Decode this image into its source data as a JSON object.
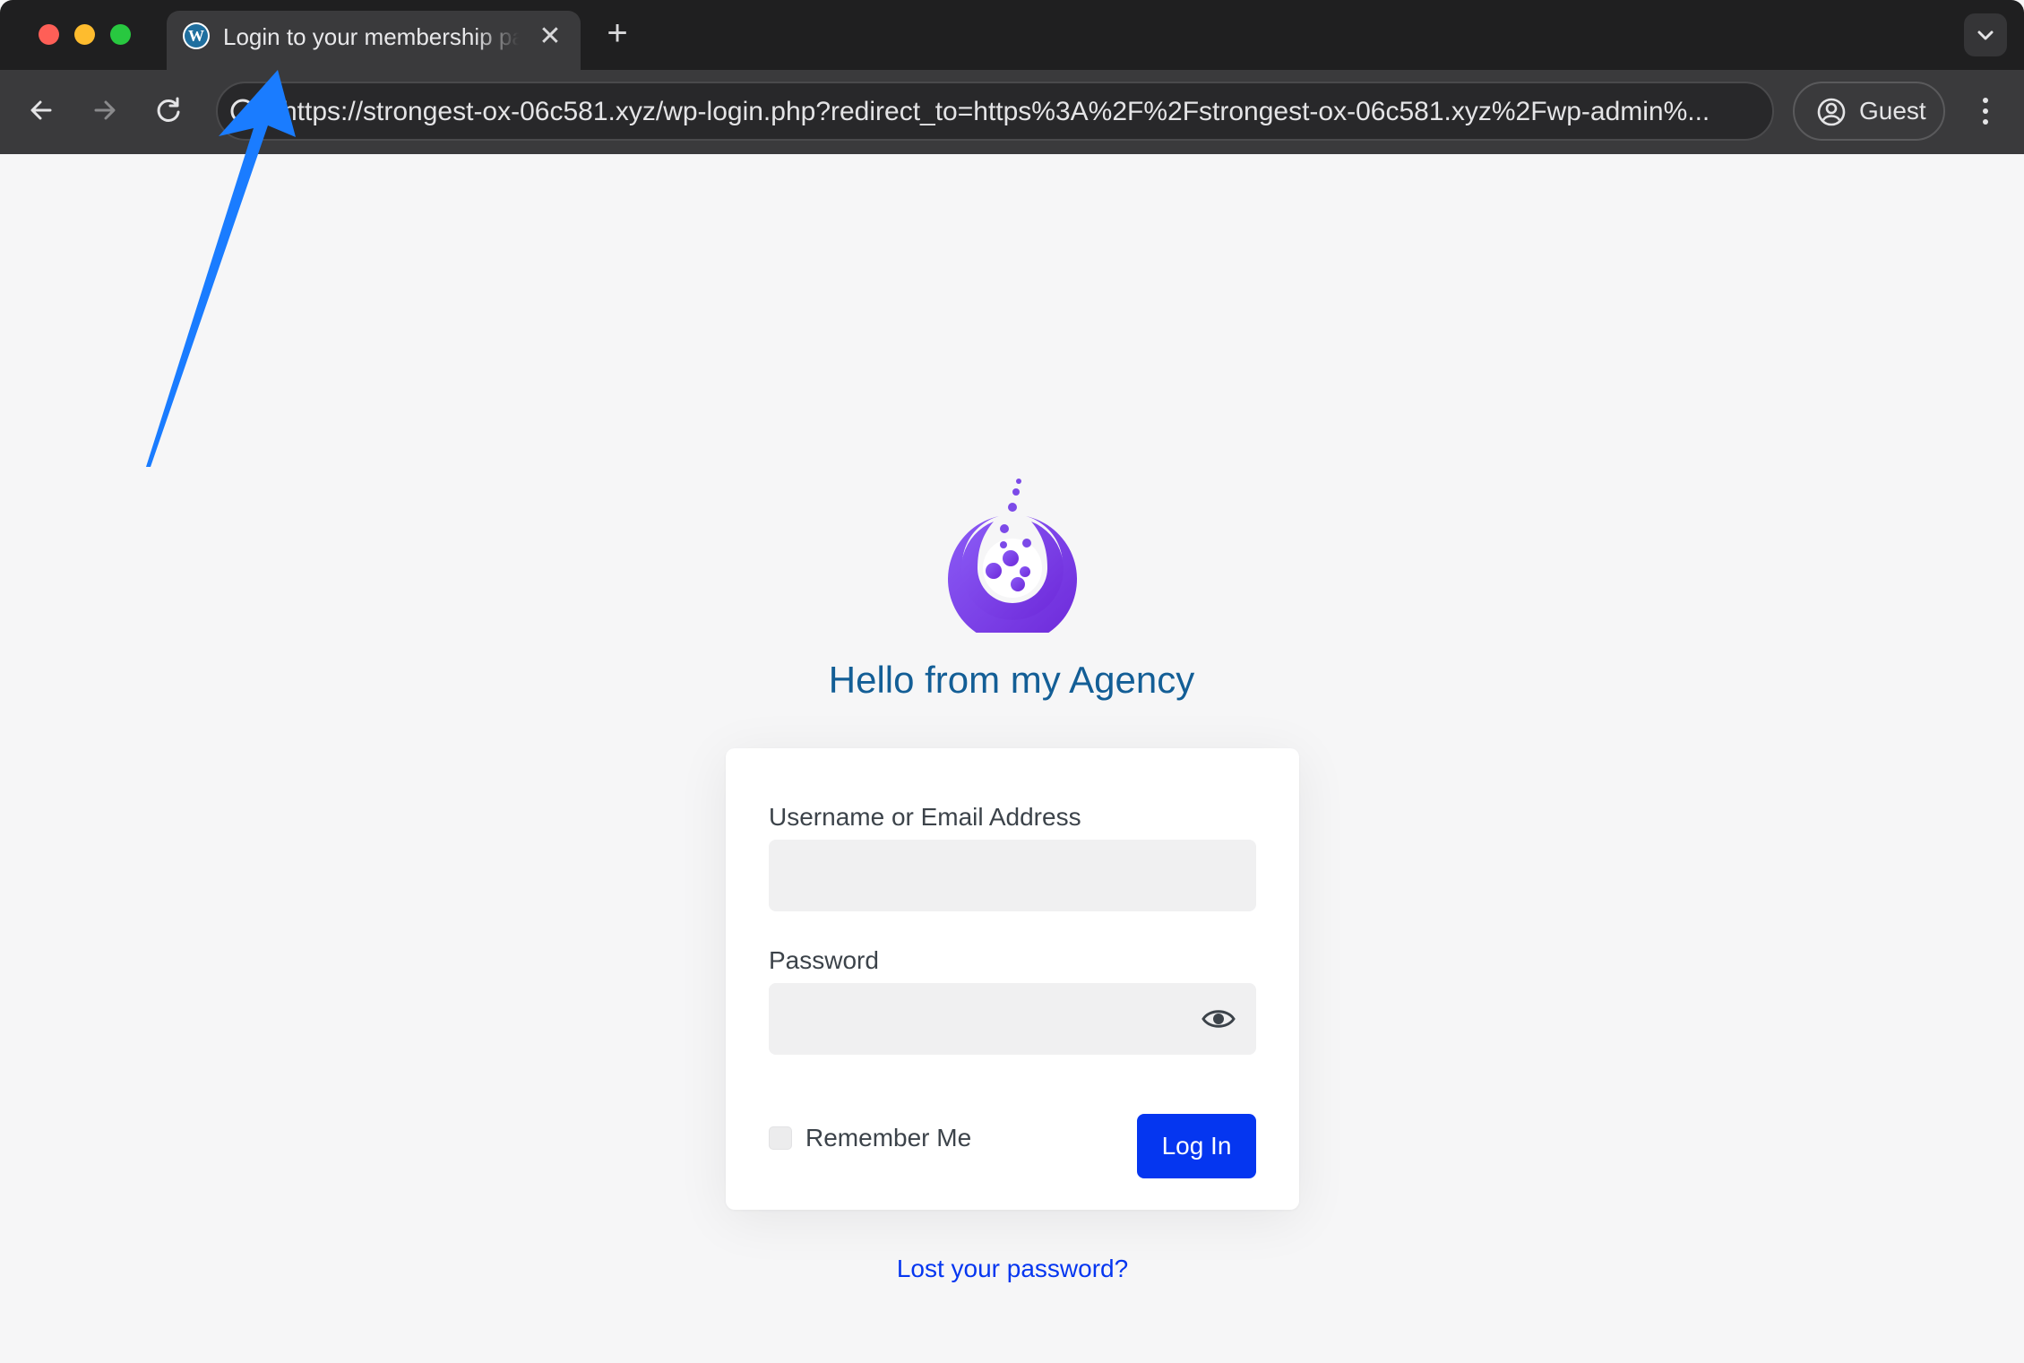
{
  "browser": {
    "tab": {
      "title": "Login to your membership page",
      "favicon": "wordpress-icon"
    },
    "new_tab_label": "+",
    "close_label": "✕",
    "url": "https://strongest-ox-06c581.xyz/wp-login.php?redirect_to=https%3A%2F%2Fstrongest-ox-06c581.xyz%2Fwp-admin%...",
    "profile_label": "Guest"
  },
  "login": {
    "site_title": "Hello from my Agency",
    "username_label": "Username or Email Address",
    "username_value": "",
    "password_label": "Password",
    "password_value": "",
    "remember_label": "Remember Me",
    "remember_checked": false,
    "login_button": "Log In",
    "lost_password": "Lost your password?"
  },
  "colors": {
    "title": "#135e96",
    "button": "#0536f0",
    "link": "#0536f0",
    "logo_gradient": [
      "#8b5cf6",
      "#6d28d9"
    ],
    "annotation_arrow": "#1a7cff"
  }
}
